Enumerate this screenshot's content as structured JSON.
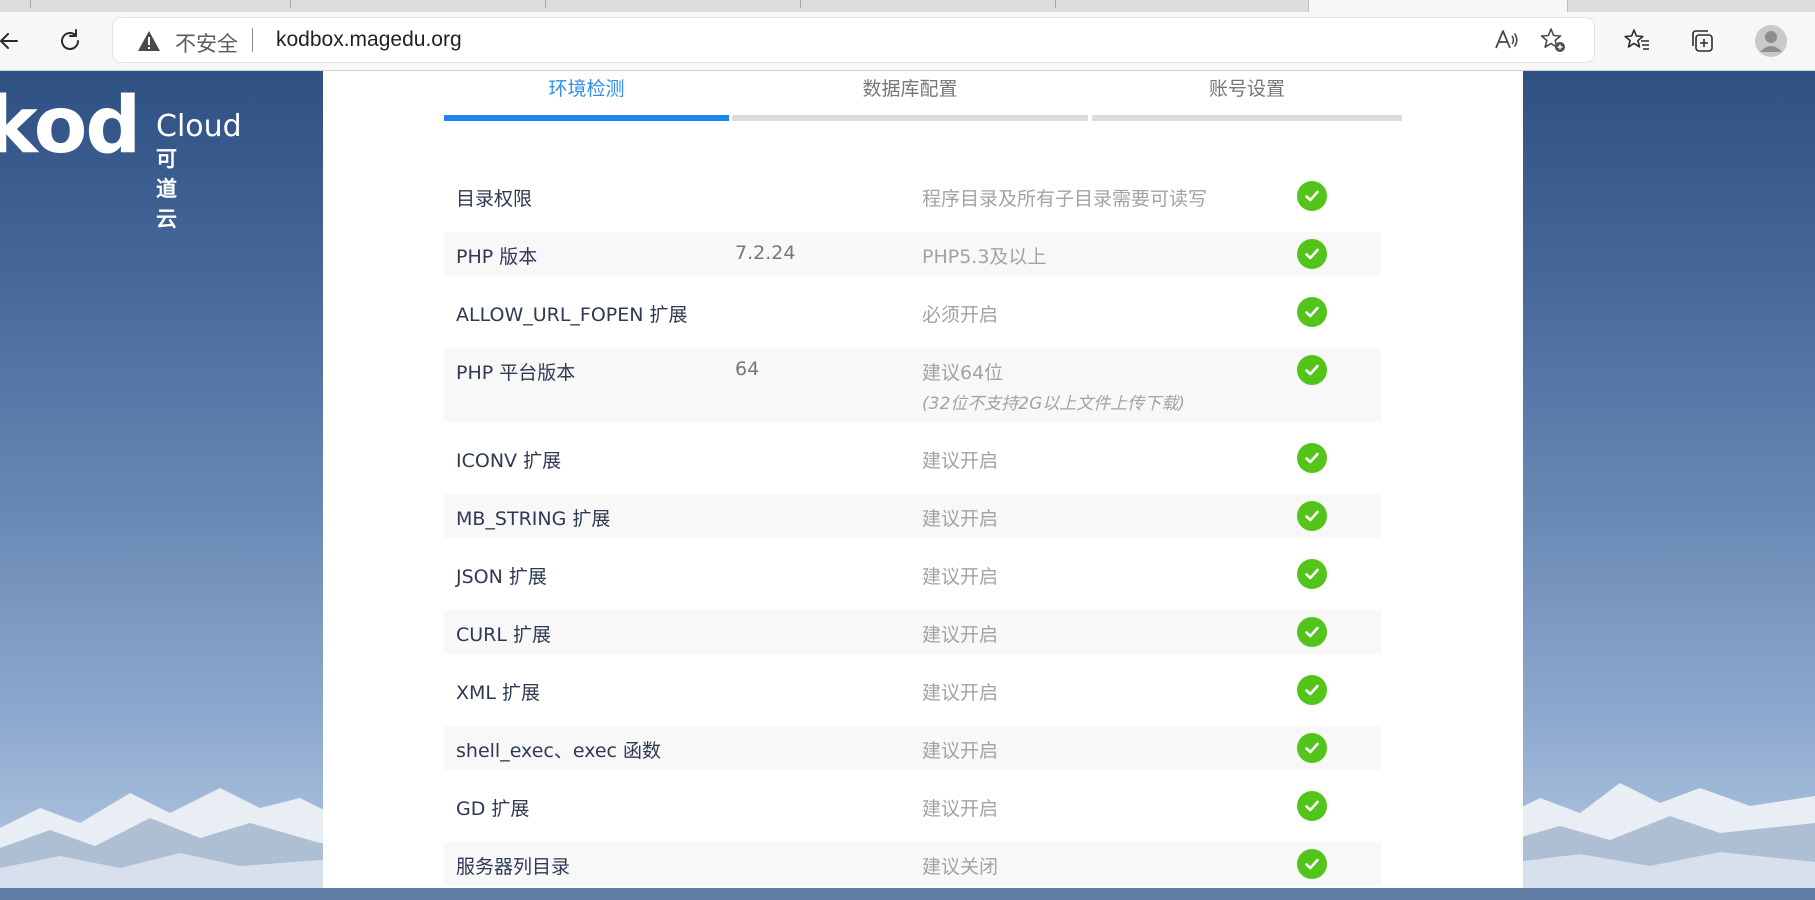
{
  "browser": {
    "security_label": "不安全",
    "url": "kodbox.magedu.org"
  },
  "logo": {
    "brand": "kod",
    "cloud": "Cloud",
    "cn": "可道云"
  },
  "steps": [
    {
      "label": "环境检测",
      "active": true
    },
    {
      "label": "数据库配置",
      "active": false
    },
    {
      "label": "账号设置",
      "active": false
    }
  ],
  "checks": [
    {
      "name": "目录权限",
      "value": "",
      "requirement": "程序目录及所有子目录需要可读写",
      "note": "",
      "ok": true
    },
    {
      "name": "PHP 版本",
      "value": "7.2.24",
      "requirement": "PHP5.3及以上",
      "note": "",
      "ok": true
    },
    {
      "name": "ALLOW_URL_FOPEN 扩展",
      "value": "",
      "requirement": "必须开启",
      "note": "",
      "ok": true
    },
    {
      "name": "PHP 平台版本",
      "value": "64",
      "requirement": "建议64位",
      "note": "(32位不支持2G以上文件上传下载)",
      "ok": true
    },
    {
      "name": "ICONV 扩展",
      "value": "",
      "requirement": "建议开启",
      "note": "",
      "ok": true
    },
    {
      "name": "MB_STRING 扩展",
      "value": "",
      "requirement": "建议开启",
      "note": "",
      "ok": true
    },
    {
      "name": "JSON 扩展",
      "value": "",
      "requirement": "建议开启",
      "note": "",
      "ok": true
    },
    {
      "name": "CURL 扩展",
      "value": "",
      "requirement": "建议开启",
      "note": "",
      "ok": true
    },
    {
      "name": "XML 扩展",
      "value": "",
      "requirement": "建议开启",
      "note": "",
      "ok": true
    },
    {
      "name": "shell_exec、exec 函数",
      "value": "",
      "requirement": "建议开启",
      "note": "",
      "ok": true
    },
    {
      "name": "GD 扩展",
      "value": "",
      "requirement": "建议开启",
      "note": "",
      "ok": true
    },
    {
      "name": "服务器列目录",
      "value": "",
      "requirement": "建议关闭",
      "note": "",
      "ok": true
    }
  ],
  "colors": {
    "accent": "#1e86f0",
    "ok": "#52c41a"
  }
}
